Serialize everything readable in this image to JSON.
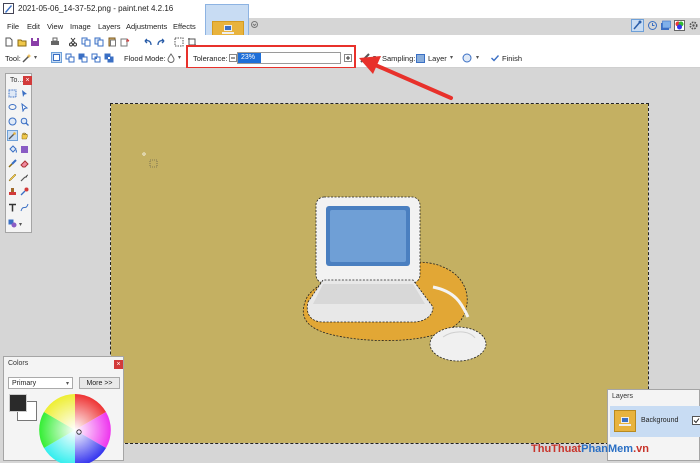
{
  "window": {
    "title": "2021-05-06_14-37-52.png - paint.net 4.2.16"
  },
  "menu": {
    "items": [
      "File",
      "Edit",
      "View",
      "Image",
      "Layers",
      "Adjustments",
      "Effects"
    ]
  },
  "toolbar2": {
    "tool_label": "Tool:",
    "flood_mode_label": "Flood Mode:",
    "tolerance_label": "Tolerance:",
    "tolerance_value": "23%",
    "tolerance_fraction": 0.23,
    "sampling_label": "Sampling:",
    "sampling_value": "Layer",
    "finish_label": "Finish"
  },
  "tools_panel": {
    "title": "To..."
  },
  "colors_panel": {
    "title": "Colors",
    "mode_select": "Primary",
    "more_button": "More >>"
  },
  "layers_panel": {
    "title": "Layers",
    "layer_name": "Background"
  },
  "watermark": {
    "part1": "ThuThuat",
    "part2": "PhanMem",
    "part3": ".vn"
  },
  "colors": {
    "canvas_bg": "#c4b062",
    "accent_blue": "#1e6fd8",
    "highlight_red": "#e8312b",
    "thumb_orange": "#e8b33d"
  }
}
